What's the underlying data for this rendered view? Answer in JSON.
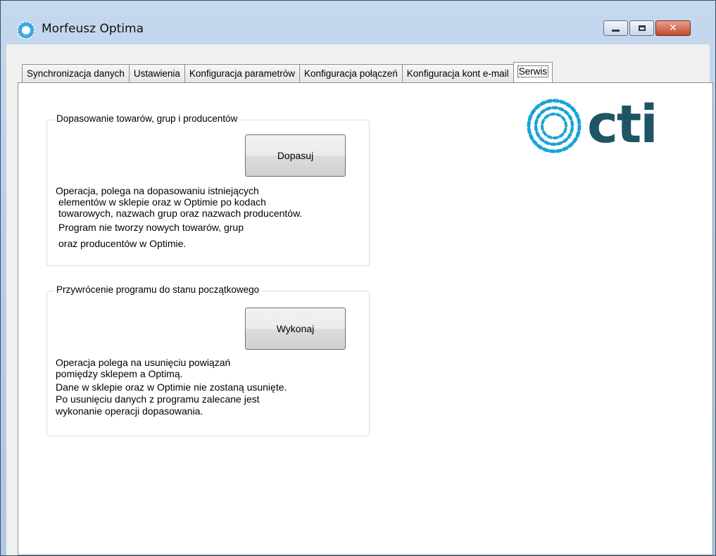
{
  "window": {
    "title": "Morfeusz Optima",
    "minimize_icon": "minimize-icon",
    "maximize_icon": "maximize-icon",
    "close_glyph": "✕"
  },
  "tabs": [
    {
      "label": "Synchronizacja danych",
      "active": false
    },
    {
      "label": "Ustawienia",
      "active": false
    },
    {
      "label": "Konfiguracja parametrów",
      "active": false
    },
    {
      "label": "Konfiguracja połączeń",
      "active": false
    },
    {
      "label": "Konfiguracja kont e-mail",
      "active": false
    },
    {
      "label": "Serwis",
      "active": true
    }
  ],
  "logo": {
    "text": "cti",
    "color": "#1d5564",
    "accent": "#1aa3d9"
  },
  "groups": {
    "match": {
      "title": "Dopasowanie towarów, grup i producentów",
      "button_label": "Dopasuj",
      "lines": [
        "Operacja, polega na dopasowaniu istniejących",
        "elementów w sklepie oraz w Optimie po kodach",
        "towarowych, nazwach grup oraz nazwach producentów.",
        "Program nie tworzy nowych towarów, grup",
        "oraz producentów w Optimie."
      ]
    },
    "reset": {
      "title": "Przywrócenie programu do stanu początkowego",
      "button_label": "Wykonaj",
      "lines": [
        "Operacja polega na usunięciu powiązań",
        "pomiędzy sklepem a Optimą.",
        "Dane w sklepie oraz w Optimie nie zostaną usunięte.",
        "Po usunięciu danych z programu zalecane jest",
        "wykonanie operacji dopasowania."
      ]
    }
  }
}
